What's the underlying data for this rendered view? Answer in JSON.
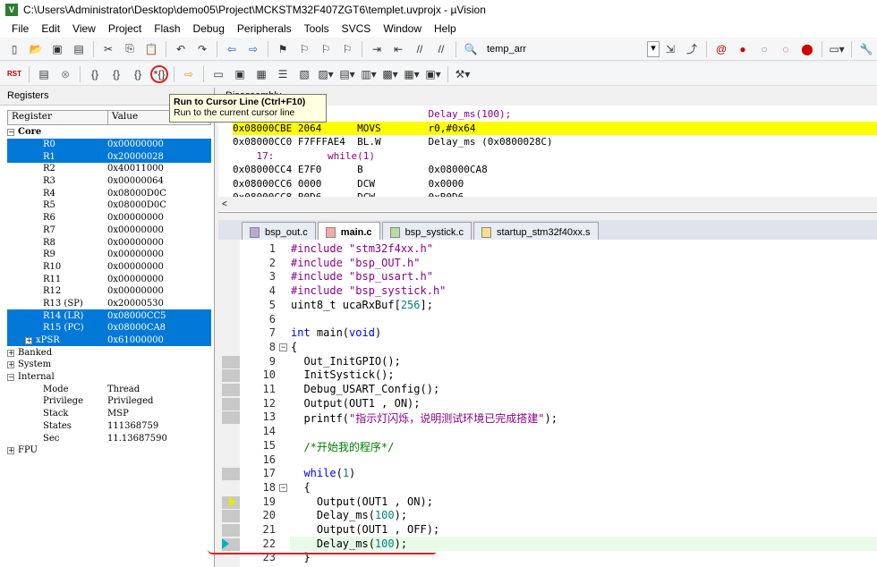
{
  "window": {
    "title": "C:\\Users\\Administrator\\Desktop\\demo05\\Project\\MCKSTM32F407ZGT6\\templet.uvprojx - µVision",
    "icon_label": "V"
  },
  "menu": [
    "File",
    "Edit",
    "View",
    "Project",
    "Flash",
    "Debug",
    "Peripherals",
    "Tools",
    "SVCS",
    "Window",
    "Help"
  ],
  "toolbar1": {
    "combo_value": "temp_arr"
  },
  "toolbar2": {
    "rst_label": "RST"
  },
  "tooltip": {
    "title": "Run to Cursor Line (Ctrl+F10)",
    "desc": "Run to the current cursor line"
  },
  "registers": {
    "panel_title": "Registers",
    "col_register": "Register",
    "col_value": "Value",
    "rows": [
      {
        "name": "Core",
        "value": "",
        "level": 0,
        "expander": "−",
        "bold": true,
        "sel": false
      },
      {
        "name": "R0",
        "value": "0x00000000",
        "level": 2,
        "sel": true
      },
      {
        "name": "R1",
        "value": "0x20000028",
        "level": 2,
        "sel": true
      },
      {
        "name": "R2",
        "value": "0x40011000",
        "level": 2,
        "sel": false
      },
      {
        "name": "R3",
        "value": "0x00000064",
        "level": 2,
        "sel": false
      },
      {
        "name": "R4",
        "value": "0x08000D0C",
        "level": 2,
        "sel": false
      },
      {
        "name": "R5",
        "value": "0x08000D0C",
        "level": 2,
        "sel": false
      },
      {
        "name": "R6",
        "value": "0x00000000",
        "level": 2,
        "sel": false
      },
      {
        "name": "R7",
        "value": "0x00000000",
        "level": 2,
        "sel": false
      },
      {
        "name": "R8",
        "value": "0x00000000",
        "level": 2,
        "sel": false
      },
      {
        "name": "R9",
        "value": "0x00000000",
        "level": 2,
        "sel": false
      },
      {
        "name": "R10",
        "value": "0x00000000",
        "level": 2,
        "sel": false
      },
      {
        "name": "R11",
        "value": "0x00000000",
        "level": 2,
        "sel": false
      },
      {
        "name": "R12",
        "value": "0x00000000",
        "level": 2,
        "sel": false
      },
      {
        "name": "R13 (SP)",
        "value": "0x20000530",
        "level": 2,
        "sel": false
      },
      {
        "name": "R14 (LR)",
        "value": "0x08000CC5",
        "level": 2,
        "sel": true
      },
      {
        "name": "R15 (PC)",
        "value": "0x08000CA8",
        "level": 2,
        "sel": true
      },
      {
        "name": "xPSR",
        "value": "0x61000000",
        "level": 1,
        "expander": "+",
        "sel": true
      },
      {
        "name": "Banked",
        "value": "",
        "level": 0,
        "expander": "+",
        "sel": false
      },
      {
        "name": "System",
        "value": "",
        "level": 0,
        "expander": "+",
        "sel": false
      },
      {
        "name": "Internal",
        "value": "",
        "level": 0,
        "expander": "−",
        "sel": false
      },
      {
        "name": "Mode",
        "value": "Thread",
        "level": 2,
        "sel": false
      },
      {
        "name": "Privilege",
        "value": "Privileged",
        "level": 2,
        "sel": false
      },
      {
        "name": "Stack",
        "value": "MSP",
        "level": 2,
        "sel": false
      },
      {
        "name": "States",
        "value": "111368759",
        "level": 2,
        "sel": false
      },
      {
        "name": "Sec",
        "value": "11.13687590",
        "level": 2,
        "sel": false
      },
      {
        "name": "FPU",
        "value": "",
        "level": 0,
        "expander": "+",
        "sel": false
      }
    ]
  },
  "disassembly": {
    "title": "Disassembly",
    "lines": [
      {
        "text": "                                 Delay_ms(100);",
        "cur": false
      },
      {
        "text": "0x08000CBE 2064      MOVS        r0,#0x64",
        "cur": true
      },
      {
        "text": "0x08000CC0 F7FFFAE4  BL.W        Delay_ms (0x0800028C)",
        "cur": false
      },
      {
        "text": "    17:         while(1)",
        "cur": false
      },
      {
        "text": "0x08000CC4 E7F0      B           0x08000CA8",
        "cur": false
      },
      {
        "text": "0x08000CC6 0000      DCW         0x0000",
        "cur": false
      },
      {
        "text": "0x08000CC8 B0D6      DCW         0xB0D6",
        "cur": false
      }
    ]
  },
  "tabs": [
    {
      "label": "bsp_out.c",
      "active": false,
      "color": "#b7a8d8"
    },
    {
      "label": "main.c",
      "active": true,
      "color": "#f7a8a8"
    },
    {
      "label": "bsp_systick.c",
      "active": false,
      "color": "#b8dca0"
    },
    {
      "label": "startup_stm32f40xx.s",
      "active": false,
      "color": "#f7e08a"
    }
  ],
  "code_lines": [
    {
      "n": "1",
      "html": "<span class=\"str\">#include \"stm32f4xx.h\"</span>"
    },
    {
      "n": "2",
      "html": "<span class=\"str\">#include \"bsp_OUT.h\"</span>"
    },
    {
      "n": "3",
      "html": "<span class=\"str\">#include \"bsp_usart.h\"</span>"
    },
    {
      "n": "4",
      "html": "<span class=\"str\">#include \"bsp_systick.h\"</span>"
    },
    {
      "n": "5",
      "html": "uint8_t ucaRxBuf[<span class=\"num\">256</span>];"
    },
    {
      "n": "6",
      "html": ""
    },
    {
      "n": "7",
      "html": "<span class=\"kw\">int</span> main(<span class=\"kw\">void</span>)"
    },
    {
      "n": "8",
      "html": "{",
      "fold": "−"
    },
    {
      "n": "9",
      "html": "  Out_InitGPIO();",
      "mark": true
    },
    {
      "n": "10",
      "html": "  InitSystick();",
      "mark": true
    },
    {
      "n": "11",
      "html": "  Debug_USART_Config();",
      "mark": true
    },
    {
      "n": "12",
      "html": "  Output(OUT1 , ON);",
      "mark": true
    },
    {
      "n": "13",
      "html": "  printf(<span class=\"str\">\"指示灯闪烁，说明测试环境已完成搭建\"</span>);",
      "mark": true
    },
    {
      "n": "14",
      "html": ""
    },
    {
      "n": "15",
      "html": "  <span class=\"cmt\">/*开始我的程序*/</span>"
    },
    {
      "n": "16",
      "html": ""
    },
    {
      "n": "17",
      "html": "  <span class=\"kw\">while</span>(<span class=\"num\">1</span>)",
      "mark": true
    },
    {
      "n": "18",
      "html": "  {",
      "fold": "−"
    },
    {
      "n": "19",
      "html": "    Output(OUT1 , ON);",
      "mark": true,
      "arrow": "y"
    },
    {
      "n": "20",
      "html": "    Delay_ms(<span class=\"num\">100</span>);",
      "mark": true
    },
    {
      "n": "21",
      "html": "    Output(OUT1 , OFF);",
      "mark": true
    },
    {
      "n": "22",
      "html": "    Delay_ms(<span class=\"num\">100</span>);",
      "mark": true,
      "arrow": "c"
    },
    {
      "n": "23",
      "html": "  }"
    }
  ]
}
